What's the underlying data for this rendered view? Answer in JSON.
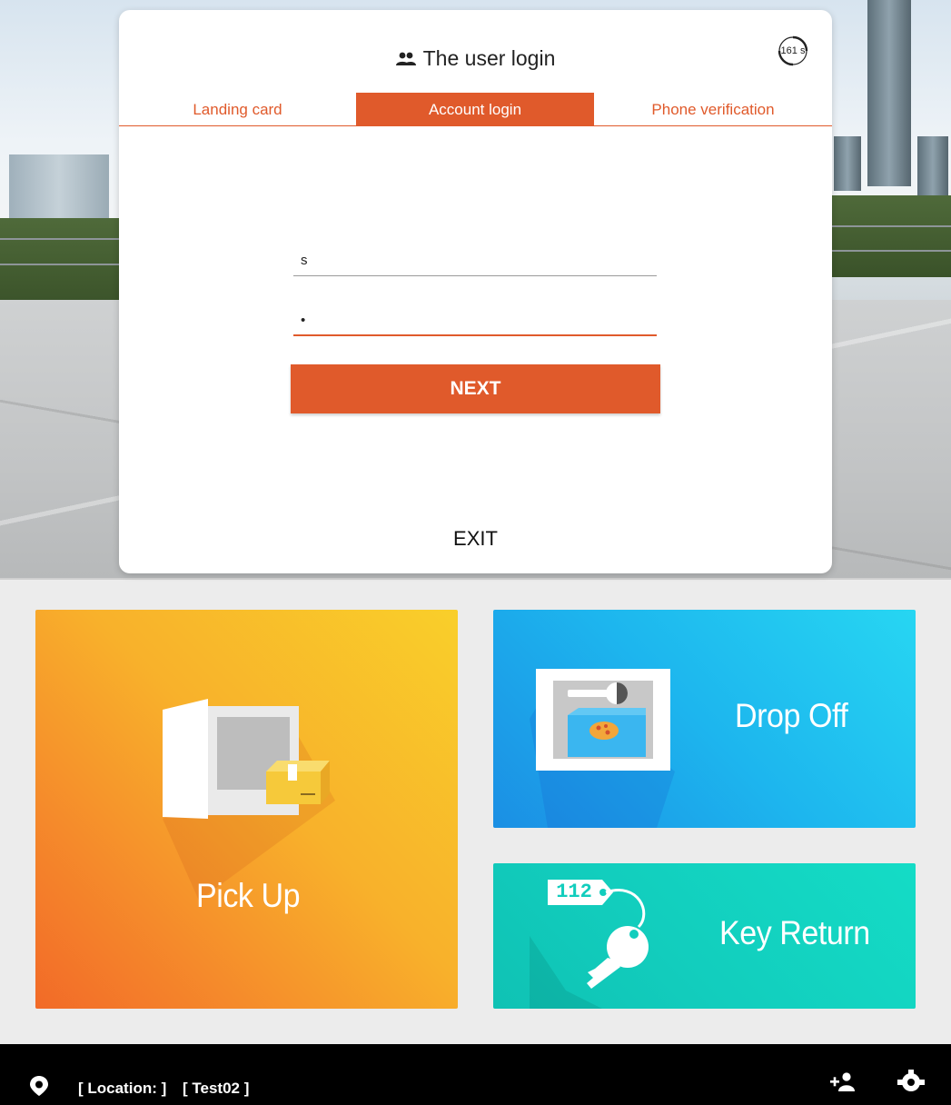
{
  "dialog": {
    "title": "The user login",
    "timer": "161 s",
    "tabs": [
      {
        "label": "Landing card"
      },
      {
        "label": "Account login"
      },
      {
        "label": "Phone verification"
      }
    ],
    "username_value": "s",
    "password_value": "•",
    "next_label": "NEXT",
    "exit_label": "EXIT"
  },
  "tiles": {
    "pickup": "Pick Up",
    "dropoff": "Drop Off",
    "keyreturn": "Key Return",
    "key_tag_number": "112"
  },
  "footer": {
    "location": "[ Location: ]",
    "user": "[ Test02 ]"
  },
  "colors": {
    "accent": "#e05a2b",
    "pickup": "#f8b12b",
    "dropoff": "#1db6ee",
    "keyreturn": "#12cdbd",
    "footer": "#000000"
  },
  "icons": [
    "people-icon",
    "timer-icon",
    "location-pin-icon",
    "add-user-icon",
    "settings-icon"
  ]
}
